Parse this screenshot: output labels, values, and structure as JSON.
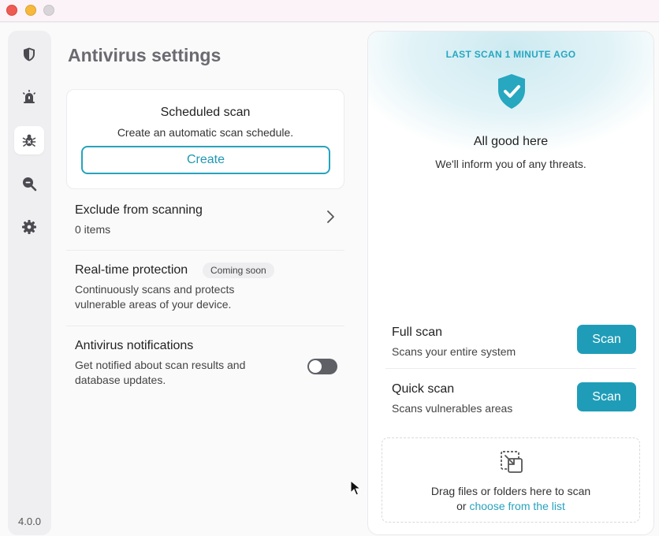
{
  "version": "4.0.0",
  "colors": {
    "accent": "#1f9db8",
    "accent_text": "#27a7c0",
    "title_gray": "#6a6a70",
    "toggle_off": "#5e6066"
  },
  "sidebar": {
    "items": [
      {
        "name": "shield-icon",
        "active": false
      },
      {
        "name": "alarm-icon",
        "active": false
      },
      {
        "name": "bug-icon",
        "active": true
      },
      {
        "name": "search-icon",
        "active": false
      },
      {
        "name": "gear-icon",
        "active": false
      }
    ]
  },
  "main": {
    "title": "Antivirus settings",
    "scheduled_scan": {
      "title": "Scheduled scan",
      "subtitle": "Create an automatic scan schedule.",
      "button": "Create"
    },
    "exclude": {
      "title": "Exclude from scanning",
      "subtitle": "0 items"
    },
    "realtime": {
      "title": "Real-time protection",
      "badge": "Coming soon",
      "subtitle_line1": "Continuously scans and protects",
      "subtitle_line2": "vulnerable areas of your device."
    },
    "notifications": {
      "title": "Antivirus notifications",
      "subtitle_line1": "Get notified about scan results and",
      "subtitle_line2": "database updates.",
      "toggle_on": false
    }
  },
  "panel": {
    "last_scan": "LAST SCAN 1 MINUTE AGO",
    "status_title": "All good here",
    "status_subtitle": "We'll inform you of any threats.",
    "full_scan": {
      "title": "Full scan",
      "subtitle": "Scans your entire system",
      "button": "Scan"
    },
    "quick_scan": {
      "title": "Quick scan",
      "subtitle": "Scans vulnerables areas",
      "button": "Scan"
    },
    "dropzone": {
      "line1": "Drag files or folders here to scan",
      "prefix": "or",
      "link": "choose from the list"
    }
  }
}
